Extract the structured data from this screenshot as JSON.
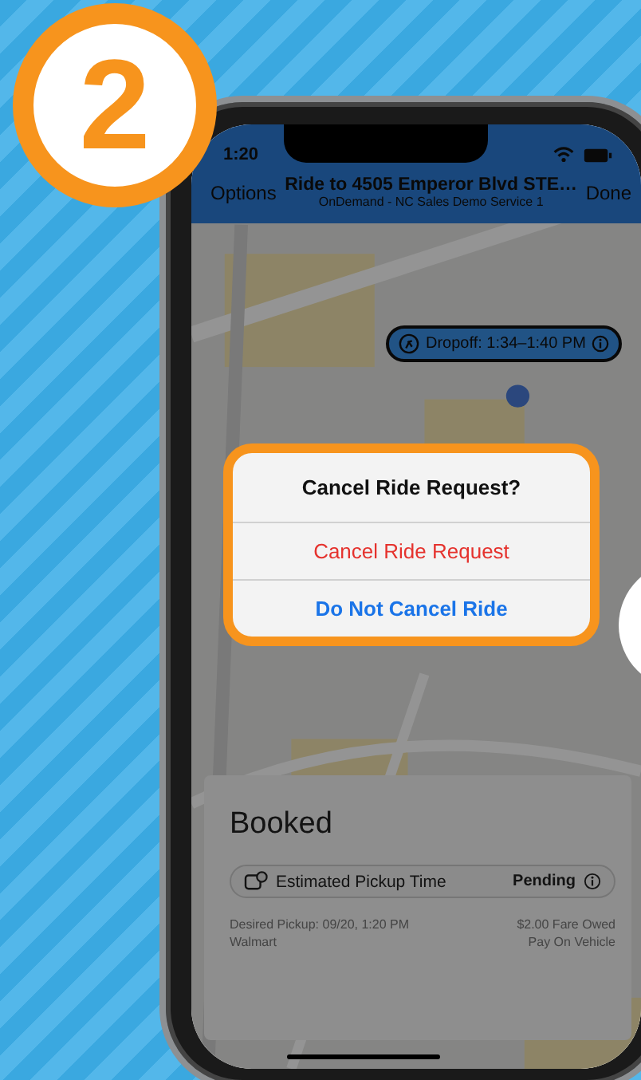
{
  "badge": {
    "number": "2"
  },
  "status_bar": {
    "time": "1:20"
  },
  "nav": {
    "left": "Options",
    "title": "Ride to 4505 Emperor Blvd STE…",
    "subtitle": "OnDemand - NC Sales Demo Service 1",
    "right": "Done"
  },
  "map": {
    "kind": "picture",
    "dropoff": "Dropoff: 1:34–1:40 PM"
  },
  "dialog": {
    "title": "Cancel Ride Request?",
    "actions": [
      {
        "label": "Cancel Ride Request",
        "kind": "destructive"
      },
      {
        "label": "Do Not Cancel Ride",
        "kind": "default"
      }
    ]
  },
  "card": {
    "status": "Booked",
    "eta": {
      "label": "Estimated Pickup Time",
      "value": "Pending"
    },
    "desired_pickup": "Desired Pickup: 09/20, 1:20 PM",
    "place": "Walmart",
    "fare": "$2.00 Fare Owed",
    "payment": "Pay On Vehicle"
  }
}
